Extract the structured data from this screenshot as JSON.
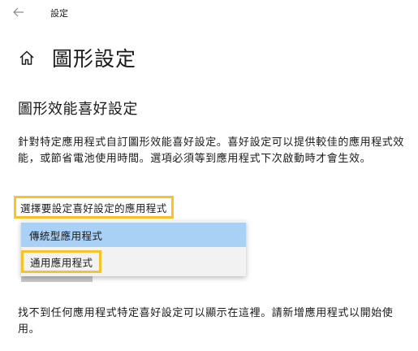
{
  "titlebar": {
    "back_icon": "arrow-left-icon",
    "title": "設定"
  },
  "header": {
    "home_icon": "home-icon",
    "page_title": "圖形設定"
  },
  "section": {
    "heading": "圖形效能喜好設定",
    "description": "針對特定應用程式自訂圖形效能喜好設定。喜好設定可以提供較佳的應用程式效能，或節省電池使用時間。選項必須等到應用程式下次啟動時才會生效。"
  },
  "app_select": {
    "label": "選擇要設定喜好設定的應用程式",
    "options": [
      {
        "label": "傳統型應用程式",
        "selected": true
      },
      {
        "label": "通用應用程式",
        "selected": false
      }
    ]
  },
  "footer": {
    "message": "找不到任何應用程式特定喜好設定可以顯示在這裡。請新增應用程式以開始使用。"
  },
  "colors": {
    "highlight_border": "#f7c325",
    "selected_option_bg": "#a9d0f5",
    "menu_bg": "#f2f2f2"
  }
}
